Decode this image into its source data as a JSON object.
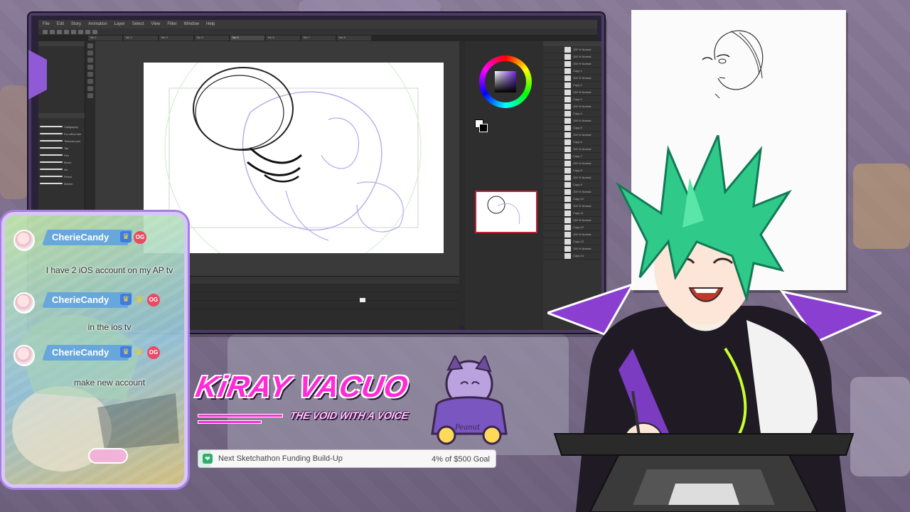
{
  "app": {
    "menu": [
      "File",
      "Edit",
      "Story",
      "Animation",
      "Layer",
      "Select",
      "View",
      "Filter",
      "Window",
      "Help"
    ],
    "tabs": [
      "Tab 1",
      "Tab 2",
      "Tab 3",
      "Tab 4",
      "Tab 5",
      "Tab 6",
      "Tab 7",
      "Tab 8"
    ],
    "brushes": [
      "Calligraphy",
      "For effect line",
      "Textured pen",
      "Tail",
      "Pen",
      "Brush",
      "Ink",
      "Pencil",
      "Marker"
    ],
    "layers": [
      "100 % Normal",
      "100 % Normal",
      "100 % Normal",
      "Copy 1",
      "100 % Normal",
      "Copy 2",
      "100 % Normal",
      "Copy 3",
      "100 % Normal",
      "Copy 4",
      "100 % Normal",
      "Copy 5",
      "100 % Normal",
      "Copy 6",
      "100 % Normal",
      "Copy 7",
      "100 % Normal",
      "Copy 8",
      "100 % Normal",
      "Copy 9",
      "100 % Normal",
      "Copy 10",
      "100 % Normal",
      "Copy 11",
      "100 % Normal",
      "Copy 12",
      "100 % Normal",
      "Copy 13",
      "100 % Normal",
      "Copy 14"
    ]
  },
  "chat": {
    "messages": [
      {
        "user": "CherieCandy",
        "text": "I have 2 iOS account on my AP tv",
        "badge_og": "OG"
      },
      {
        "user": "CherieCandy",
        "text": "in the ios tv",
        "badge_og": "OG"
      },
      {
        "user": "CherieCandy",
        "text": "make new account",
        "badge_og": "OG"
      }
    ]
  },
  "logo": {
    "title": "KiRAY VACUO",
    "subtitle": "THE VOID WITH A VOICE",
    "mascot_label": "Peanut"
  },
  "goal": {
    "label": "Next Sketchathon Funding Build-Up",
    "amount": "4% of $500 Goal",
    "progress": 0.04,
    "icon": "gift-icon"
  },
  "colors": {
    "accent": "#ff2bd6",
    "frame": "#a47fe0",
    "chat_name_bg": "#68a7db",
    "hair": "#2fc98a"
  }
}
